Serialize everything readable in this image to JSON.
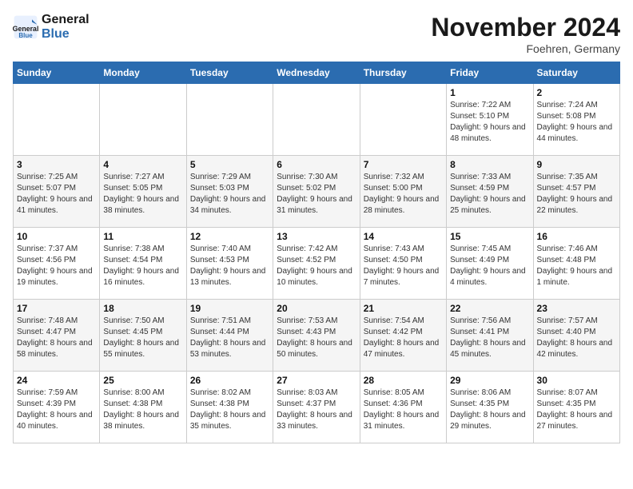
{
  "header": {
    "logo_line1": "General",
    "logo_line2": "Blue",
    "month_title": "November 2024",
    "location": "Foehren, Germany"
  },
  "weekdays": [
    "Sunday",
    "Monday",
    "Tuesday",
    "Wednesday",
    "Thursday",
    "Friday",
    "Saturday"
  ],
  "weeks": [
    [
      {
        "day": "",
        "info": ""
      },
      {
        "day": "",
        "info": ""
      },
      {
        "day": "",
        "info": ""
      },
      {
        "day": "",
        "info": ""
      },
      {
        "day": "",
        "info": ""
      },
      {
        "day": "1",
        "info": "Sunrise: 7:22 AM\nSunset: 5:10 PM\nDaylight: 9 hours\nand 48 minutes."
      },
      {
        "day": "2",
        "info": "Sunrise: 7:24 AM\nSunset: 5:08 PM\nDaylight: 9 hours\nand 44 minutes."
      }
    ],
    [
      {
        "day": "3",
        "info": "Sunrise: 7:25 AM\nSunset: 5:07 PM\nDaylight: 9 hours\nand 41 minutes."
      },
      {
        "day": "4",
        "info": "Sunrise: 7:27 AM\nSunset: 5:05 PM\nDaylight: 9 hours\nand 38 minutes."
      },
      {
        "day": "5",
        "info": "Sunrise: 7:29 AM\nSunset: 5:03 PM\nDaylight: 9 hours\nand 34 minutes."
      },
      {
        "day": "6",
        "info": "Sunrise: 7:30 AM\nSunset: 5:02 PM\nDaylight: 9 hours\nand 31 minutes."
      },
      {
        "day": "7",
        "info": "Sunrise: 7:32 AM\nSunset: 5:00 PM\nDaylight: 9 hours\nand 28 minutes."
      },
      {
        "day": "8",
        "info": "Sunrise: 7:33 AM\nSunset: 4:59 PM\nDaylight: 9 hours\nand 25 minutes."
      },
      {
        "day": "9",
        "info": "Sunrise: 7:35 AM\nSunset: 4:57 PM\nDaylight: 9 hours\nand 22 minutes."
      }
    ],
    [
      {
        "day": "10",
        "info": "Sunrise: 7:37 AM\nSunset: 4:56 PM\nDaylight: 9 hours\nand 19 minutes."
      },
      {
        "day": "11",
        "info": "Sunrise: 7:38 AM\nSunset: 4:54 PM\nDaylight: 9 hours\nand 16 minutes."
      },
      {
        "day": "12",
        "info": "Sunrise: 7:40 AM\nSunset: 4:53 PM\nDaylight: 9 hours\nand 13 minutes."
      },
      {
        "day": "13",
        "info": "Sunrise: 7:42 AM\nSunset: 4:52 PM\nDaylight: 9 hours\nand 10 minutes."
      },
      {
        "day": "14",
        "info": "Sunrise: 7:43 AM\nSunset: 4:50 PM\nDaylight: 9 hours\nand 7 minutes."
      },
      {
        "day": "15",
        "info": "Sunrise: 7:45 AM\nSunset: 4:49 PM\nDaylight: 9 hours\nand 4 minutes."
      },
      {
        "day": "16",
        "info": "Sunrise: 7:46 AM\nSunset: 4:48 PM\nDaylight: 9 hours\nand 1 minute."
      }
    ],
    [
      {
        "day": "17",
        "info": "Sunrise: 7:48 AM\nSunset: 4:47 PM\nDaylight: 8 hours\nand 58 minutes."
      },
      {
        "day": "18",
        "info": "Sunrise: 7:50 AM\nSunset: 4:45 PM\nDaylight: 8 hours\nand 55 minutes."
      },
      {
        "day": "19",
        "info": "Sunrise: 7:51 AM\nSunset: 4:44 PM\nDaylight: 8 hours\nand 53 minutes."
      },
      {
        "day": "20",
        "info": "Sunrise: 7:53 AM\nSunset: 4:43 PM\nDaylight: 8 hours\nand 50 minutes."
      },
      {
        "day": "21",
        "info": "Sunrise: 7:54 AM\nSunset: 4:42 PM\nDaylight: 8 hours\nand 47 minutes."
      },
      {
        "day": "22",
        "info": "Sunrise: 7:56 AM\nSunset: 4:41 PM\nDaylight: 8 hours\nand 45 minutes."
      },
      {
        "day": "23",
        "info": "Sunrise: 7:57 AM\nSunset: 4:40 PM\nDaylight: 8 hours\nand 42 minutes."
      }
    ],
    [
      {
        "day": "24",
        "info": "Sunrise: 7:59 AM\nSunset: 4:39 PM\nDaylight: 8 hours\nand 40 minutes."
      },
      {
        "day": "25",
        "info": "Sunrise: 8:00 AM\nSunset: 4:38 PM\nDaylight: 8 hours\nand 38 minutes."
      },
      {
        "day": "26",
        "info": "Sunrise: 8:02 AM\nSunset: 4:38 PM\nDaylight: 8 hours\nand 35 minutes."
      },
      {
        "day": "27",
        "info": "Sunrise: 8:03 AM\nSunset: 4:37 PM\nDaylight: 8 hours\nand 33 minutes."
      },
      {
        "day": "28",
        "info": "Sunrise: 8:05 AM\nSunset: 4:36 PM\nDaylight: 8 hours\nand 31 minutes."
      },
      {
        "day": "29",
        "info": "Sunrise: 8:06 AM\nSunset: 4:35 PM\nDaylight: 8 hours\nand 29 minutes."
      },
      {
        "day": "30",
        "info": "Sunrise: 8:07 AM\nSunset: 4:35 PM\nDaylight: 8 hours\nand 27 minutes."
      }
    ]
  ]
}
